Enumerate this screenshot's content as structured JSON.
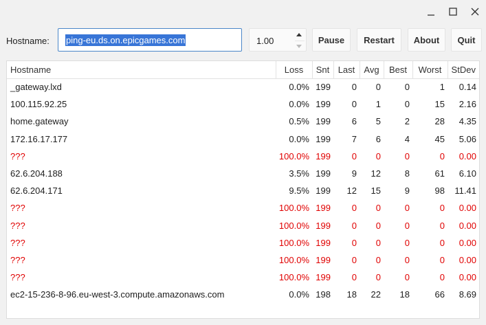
{
  "window": {
    "controls": [
      "minimize-icon",
      "maximize-icon",
      "close-icon"
    ]
  },
  "toolbar": {
    "hostname_label": "Hostname:",
    "hostname_value": "ping-eu.ds.on.epicgames.com",
    "interval_value": "1.00",
    "pause_label": "Pause",
    "restart_label": "Restart",
    "about_label": "About",
    "quit_label": "Quit"
  },
  "table": {
    "columns": [
      "Hostname",
      "Loss",
      "Snt",
      "Last",
      "Avg",
      "Best",
      "Worst",
      "StDev"
    ],
    "rows": [
      {
        "host": "_gateway.lxd",
        "loss": "0.0%",
        "snt": "199",
        "last": "0",
        "avg": "0",
        "best": "0",
        "worst": "1",
        "stdev": "0.14",
        "dead": false
      },
      {
        "host": "100.115.92.25",
        "loss": "0.0%",
        "snt": "199",
        "last": "0",
        "avg": "1",
        "best": "0",
        "worst": "15",
        "stdev": "2.16",
        "dead": false
      },
      {
        "host": "home.gateway",
        "loss": "0.5%",
        "snt": "199",
        "last": "6",
        "avg": "5",
        "best": "2",
        "worst": "28",
        "stdev": "4.35",
        "dead": false
      },
      {
        "host": "172.16.17.177",
        "loss": "0.0%",
        "snt": "199",
        "last": "7",
        "avg": "6",
        "best": "4",
        "worst": "45",
        "stdev": "5.06",
        "dead": false
      },
      {
        "host": "???",
        "loss": "100.0%",
        "snt": "199",
        "last": "0",
        "avg": "0",
        "best": "0",
        "worst": "0",
        "stdev": "0.00",
        "dead": true
      },
      {
        "host": "62.6.204.188",
        "loss": "3.5%",
        "snt": "199",
        "last": "9",
        "avg": "12",
        "best": "8",
        "worst": "61",
        "stdev": "6.10",
        "dead": false
      },
      {
        "host": "62.6.204.171",
        "loss": "9.5%",
        "snt": "199",
        "last": "12",
        "avg": "15",
        "best": "9",
        "worst": "98",
        "stdev": "11.41",
        "dead": false
      },
      {
        "host": "???",
        "loss": "100.0%",
        "snt": "199",
        "last": "0",
        "avg": "0",
        "best": "0",
        "worst": "0",
        "stdev": "0.00",
        "dead": true
      },
      {
        "host": "???",
        "loss": "100.0%",
        "snt": "199",
        "last": "0",
        "avg": "0",
        "best": "0",
        "worst": "0",
        "stdev": "0.00",
        "dead": true
      },
      {
        "host": "???",
        "loss": "100.0%",
        "snt": "199",
        "last": "0",
        "avg": "0",
        "best": "0",
        "worst": "0",
        "stdev": "0.00",
        "dead": true
      },
      {
        "host": "???",
        "loss": "100.0%",
        "snt": "199",
        "last": "0",
        "avg": "0",
        "best": "0",
        "worst": "0",
        "stdev": "0.00",
        "dead": true
      },
      {
        "host": "???",
        "loss": "100.0%",
        "snt": "199",
        "last": "0",
        "avg": "0",
        "best": "0",
        "worst": "0",
        "stdev": "0.00",
        "dead": true
      },
      {
        "host": "ec2-15-236-8-96.eu-west-3.compute.amazonaws.com",
        "loss": "0.0%",
        "snt": "198",
        "last": "18",
        "avg": "22",
        "best": "18",
        "worst": "66",
        "stdev": "8.69",
        "dead": false
      }
    ]
  },
  "colors": {
    "unreachable": "#e00000",
    "selection": "#3875d7",
    "focus_border": "#4a86c8"
  }
}
